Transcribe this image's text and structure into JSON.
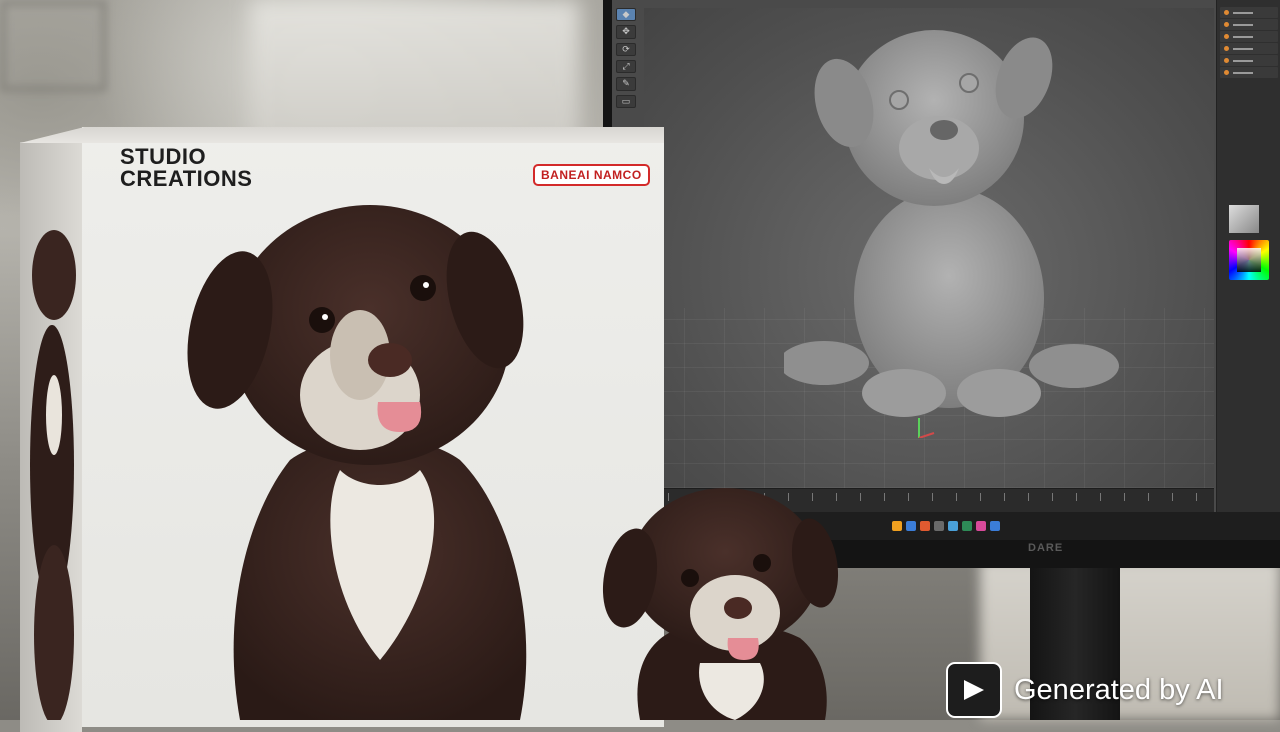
{
  "box": {
    "title_line1": "STUDIO",
    "title_line2": "CREATIONS",
    "brand": "BANEAI NAMCO"
  },
  "monitor": {
    "brand": "DARE"
  },
  "watermark": {
    "text": "Generated by AI",
    "icon": "play-sparkle-icon"
  },
  "colors": {
    "box_white": "#eeeeeb",
    "brand_red": "#d32a2a",
    "fur_dark": "#3a2520",
    "fur_light": "#e9e4dc",
    "sculpt_grey": "#9a9a9a"
  }
}
